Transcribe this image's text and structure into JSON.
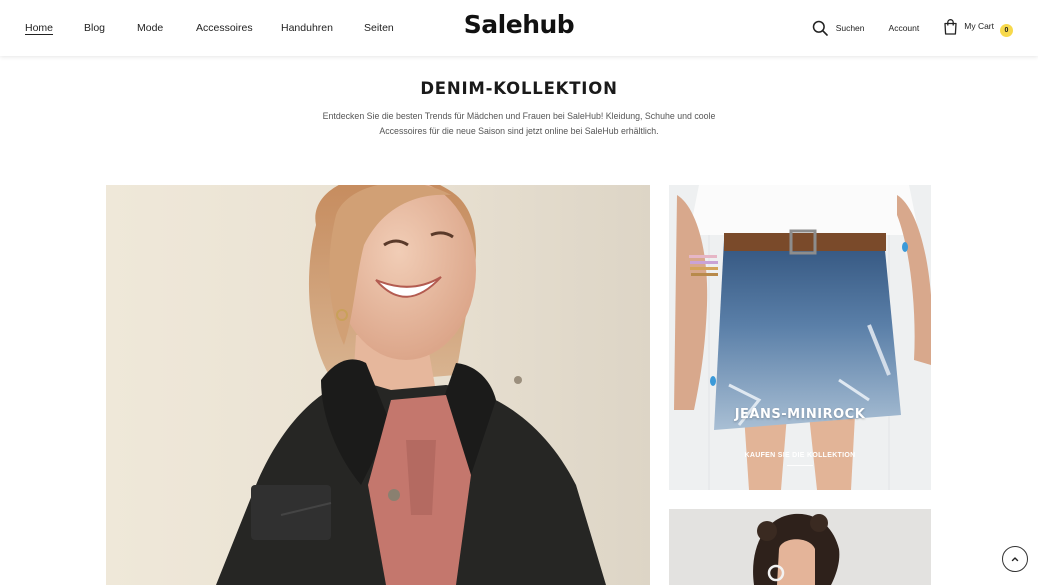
{
  "header": {
    "nav": [
      "Home",
      "Blog",
      "Mode",
      "Accessoires",
      "Handuhren",
      "Seiten"
    ],
    "logo": "Salehub",
    "search_label": "Suchen",
    "account_label": "Account",
    "cart_label": "My Cart",
    "cart_count": "0"
  },
  "section": {
    "title": "DENIM-KOLLEKTION",
    "description": "Entdecken Sie die besten Trends für Mädchen und Frauen bei SaleHub! Kleidung, Schuhe und coole Accessoires für die neue Saison sind jetzt online bei SaleHub erhältlich."
  },
  "cards": {
    "side1_title": "JEANS-MINIROCK",
    "side1_link": "KAUFEN SIE DIE KOLLEKTION"
  },
  "icons": {
    "search": "search-icon",
    "cart": "shopping-bag-icon",
    "scroll_top": "chevron-up-icon"
  },
  "colors": {
    "cart_badge": "#f7d94c",
    "text": "#1a1a1a"
  }
}
